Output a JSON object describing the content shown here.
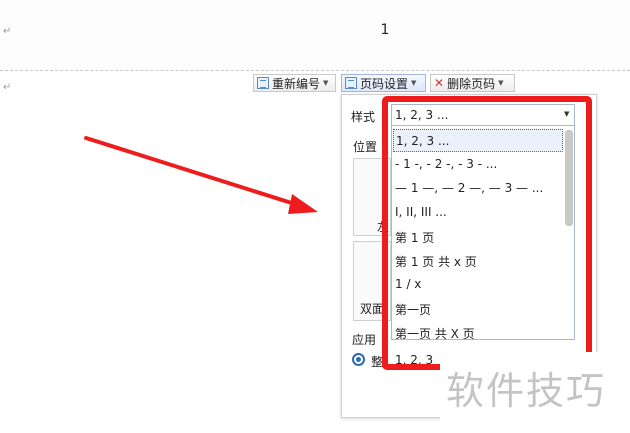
{
  "document": {
    "header_page_number": "1",
    "paragraph_mark": "↵"
  },
  "toolbar": {
    "renumber_label": "重新编号",
    "page_settings_label": "页码设置",
    "delete_page_number_label": "删除页码"
  },
  "panel": {
    "style_label": "样式",
    "style_selected": "1, 2, 3 ...",
    "position_label": "位置",
    "position_peek_1": "左",
    "double_sided_label": "双面",
    "apply_label": "应用",
    "apply_option_peek": "整",
    "apply_option_value": "1, 2, 3"
  },
  "style_options": [
    "1, 2, 3 ...",
    "- 1 -, - 2 -, - 3 - ...",
    "— 1 —, — 2 —, — 3 — ...",
    "I, II, III ...",
    "第 1 页",
    "第 1 页 共 x 页",
    "1 / x",
    "第一页",
    "第一页 共 X 页"
  ],
  "watermark": {
    "text": "软件技巧"
  },
  "colors": {
    "annotation_red": "#ee1c1c",
    "accent_blue": "#2f6ab3"
  },
  "icons": {
    "renumber": "renumber-icon",
    "page_settings": "page-settings-icon",
    "delete": "delete-x-icon",
    "dropdown": "chevron-down-icon"
  }
}
